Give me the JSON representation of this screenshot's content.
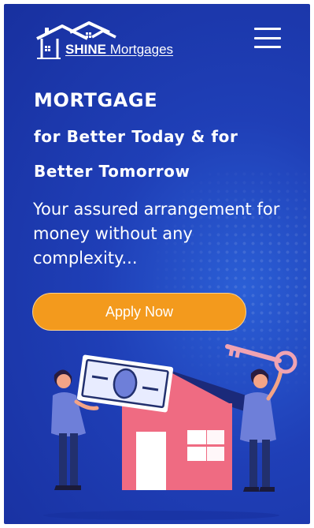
{
  "brand": {
    "name_bold": "SHINE",
    "name_rest": "Mortgages",
    "logo_icon": "house-roofs-icon"
  },
  "header": {
    "menu_icon": "hamburger-menu-icon"
  },
  "hero": {
    "title_line1": "MORTGAGE",
    "title_line2": "for Better Today & for",
    "title_line3": "Better Tomorrow",
    "subtitle": "Your assured arrangement for money without any complexity...",
    "cta_label": "Apply Now"
  },
  "colors": {
    "background": "#1f3fb7",
    "cta": "#f39a1d",
    "house": "#ef6b82",
    "figure": "#6e7fd9"
  }
}
